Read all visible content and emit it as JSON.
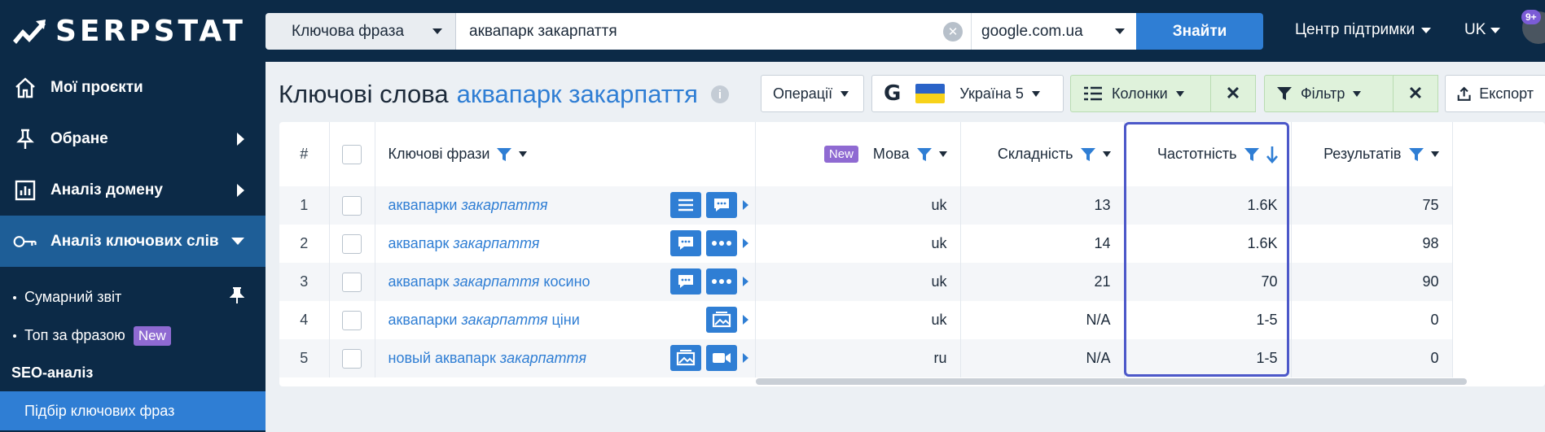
{
  "brand": {
    "name": "SERPSTAT"
  },
  "search": {
    "type_label": "Ключова фраза",
    "query": "аквапарк закарпаття",
    "engine": "google.com.ua",
    "button": "Знайти"
  },
  "header": {
    "support": "Центр підтримки",
    "lang": "UK",
    "notifications": "9+"
  },
  "sidebar": {
    "items": [
      {
        "label": "Мої проєкти"
      },
      {
        "label": "Обране"
      },
      {
        "label": "Аналіз домену"
      },
      {
        "label": "Аналіз ключових слів"
      }
    ],
    "sub_items": [
      {
        "label": "Сумарний звіт"
      },
      {
        "label": "Топ за фразою",
        "badge": "New"
      }
    ],
    "section": "SEO-аналіз",
    "selected": "Підбір ключових фраз"
  },
  "page": {
    "title": "Ключові слова",
    "query": "аквапарк закарпаття",
    "info": "i"
  },
  "toolbar": {
    "operations": "Операції",
    "region": "Україна 5",
    "columns": "Колонки",
    "filter": "Фільтр",
    "export": "Експорт",
    "google": "G",
    "close": "✕"
  },
  "table": {
    "headers": {
      "num": "#",
      "keywords": "Ключові фрази",
      "new_badge": "New",
      "lang": "Мова",
      "difficulty": "Складність",
      "frequency": "Частотність",
      "results": "Результатів"
    },
    "rows": [
      {
        "num": "1",
        "kw_plain": "аквапарки ",
        "kw_em": "закарпаття",
        "kw_tail": "",
        "lang": "uk",
        "difficulty": "13",
        "frequency": "1.6K",
        "results": "75"
      },
      {
        "num": "2",
        "kw_plain": "аквапарк ",
        "kw_em": "закарпаття",
        "kw_tail": "",
        "lang": "uk",
        "difficulty": "14",
        "frequency": "1.6K",
        "results": "98"
      },
      {
        "num": "3",
        "kw_plain": "аквапарк ",
        "kw_em": "закарпаття",
        "kw_tail": " косино",
        "lang": "uk",
        "difficulty": "21",
        "frequency": "70",
        "results": "90"
      },
      {
        "num": "4",
        "kw_plain": "аквапарки ",
        "kw_em": "закарпаття",
        "kw_tail": " ціни",
        "lang": "uk",
        "difficulty": "N/A",
        "frequency": "1-5",
        "results": "0"
      },
      {
        "num": "5",
        "kw_plain": "новый аквапарк ",
        "kw_em": "закарпаття",
        "kw_tail": "",
        "lang": "ru",
        "difficulty": "N/A",
        "frequency": "1-5",
        "results": "0"
      }
    ]
  },
  "colors": {
    "nav_bg": "#0c2a47",
    "accent": "#2f7ed4",
    "highlight": "#4c58c9",
    "badge": "#8f6ad2"
  }
}
